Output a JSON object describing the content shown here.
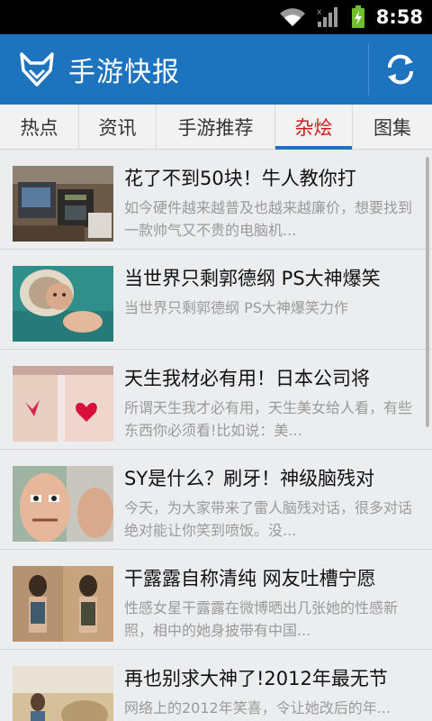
{
  "status_bar": {
    "time": "8:58",
    "icons": [
      "wifi-icon",
      "signal-icon",
      "battery-charging-icon"
    ]
  },
  "app_bar": {
    "title": "手游快报",
    "logo_icon": "fox-logo-icon",
    "refresh_icon": "refresh-icon"
  },
  "tabs": [
    {
      "label": "热点",
      "active": false
    },
    {
      "label": "资讯",
      "active": false
    },
    {
      "label": "手游推荐",
      "active": true
    },
    {
      "label": "杂烩",
      "active": false
    },
    {
      "label": "图集",
      "active": false
    }
  ],
  "articles": [
    {
      "title": "花了不到50块！牛人教你打",
      "summary": "如今硬件越来越普及也越来越廉价，想要找到一款帅气又不贵的电脑机..."
    },
    {
      "title": "当世界只剩郭德纲 PS大神爆笑",
      "summary": "当世界只剩郭德纲 PS大神爆笑力作"
    },
    {
      "title": "天生我材必有用！日本公司将",
      "summary": "所谓天生我才必有用，天生美女给人看，有些东西你必须看!比如说：美..."
    },
    {
      "title": "SY是什么？刷牙！神级脑残对",
      "summary": "今天，为大家带来了雷人脑残对话，很多对话绝对能让你笑到喷饭。没..."
    },
    {
      "title": "干露露自称清纯 网友吐槽宁愿",
      "summary": "性感女星干露露在微博晒出几张她的性感新照，相中的她身披带有中国..."
    },
    {
      "title": "再也别求大神了!2012年最无节",
      "summary": "网络上的2012年笑喜，令让她改后的年..."
    }
  ],
  "colors": {
    "app_bar": "#1d73bd",
    "active_tab_text": "#c8231e",
    "tab_indicator": "#1d73bd"
  }
}
